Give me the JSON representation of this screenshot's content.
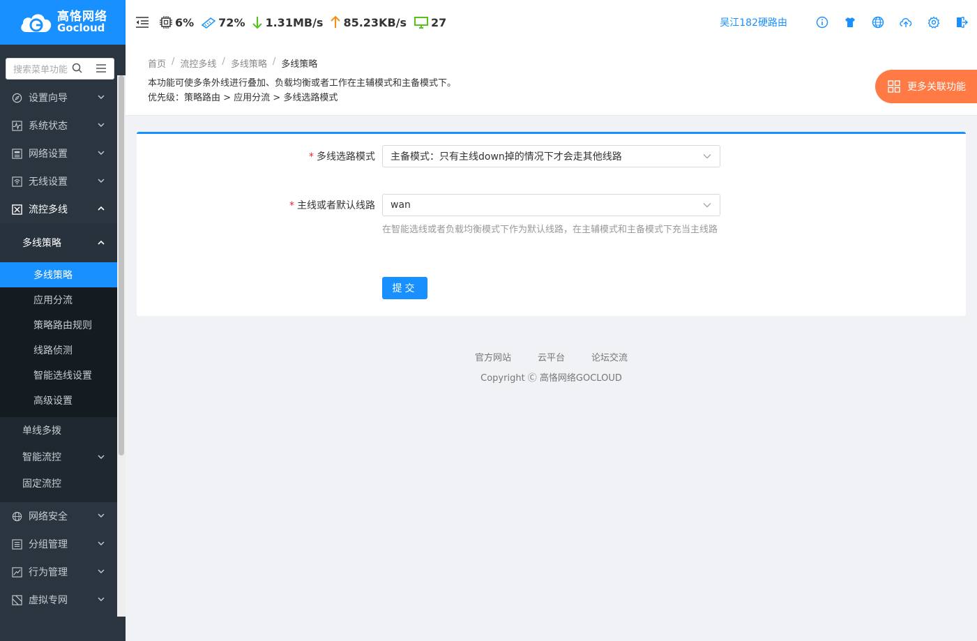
{
  "brand": {
    "cn": "高恪网络",
    "en": "Gocloud"
  },
  "sidebar": {
    "search_placeholder": "搜索菜单功能",
    "items": [
      {
        "label": "设置向导"
      },
      {
        "label": "系统状态"
      },
      {
        "label": "网络设置"
      },
      {
        "label": "无线设置"
      },
      {
        "label": "流控多线"
      }
    ],
    "submenu_head": "多线策略",
    "subitems": [
      {
        "label": "多线策略"
      },
      {
        "label": "应用分流"
      },
      {
        "label": "策略路由规则"
      },
      {
        "label": "线路侦测"
      },
      {
        "label": "智能选线设置"
      },
      {
        "label": "高级设置"
      }
    ],
    "level2": [
      {
        "label": "单线多拨"
      },
      {
        "label": "智能流控"
      },
      {
        "label": "固定流控"
      }
    ],
    "bottom_items": [
      {
        "label": "网络安全"
      },
      {
        "label": "分组管理"
      },
      {
        "label": "行为管理"
      },
      {
        "label": "虚拟专网"
      }
    ]
  },
  "header": {
    "cpu": "6%",
    "mem": "72%",
    "download": "1.31MB/s",
    "upload": "85.23KB/s",
    "devices": "27",
    "router_name": "吴江182硬路由"
  },
  "page": {
    "breadcrumb": [
      "首页",
      "流控多线",
      "多线策略",
      "多线策略"
    ],
    "desc1": "本功能可使多条外线进行叠加、负载均衡或者工作在主辅模式和主备模式下。",
    "desc2": "优先级：策略路由 > 应用分流 > 多线选路模式",
    "more_label": "更多关联功能"
  },
  "form": {
    "mode_label": "多线选路模式",
    "mode_value": "主备模式：只有主线down掉的情况下才会走其他线路",
    "line_label": "主线或者默认线路",
    "line_value": "wan",
    "help": "在智能选线或者负载均衡模式下作为默认线路，在主辅模式和主备模式下充当主线路",
    "submit": "提交"
  },
  "footer": {
    "links": [
      "官方网站",
      "云平台",
      "论坛交流"
    ],
    "copyright": "Copyright Ⓒ 高恪网络GOCLOUD"
  },
  "colors": {
    "primary": "#1890ff",
    "sidebar": "#2a3540",
    "accent": "#ff7a45"
  }
}
